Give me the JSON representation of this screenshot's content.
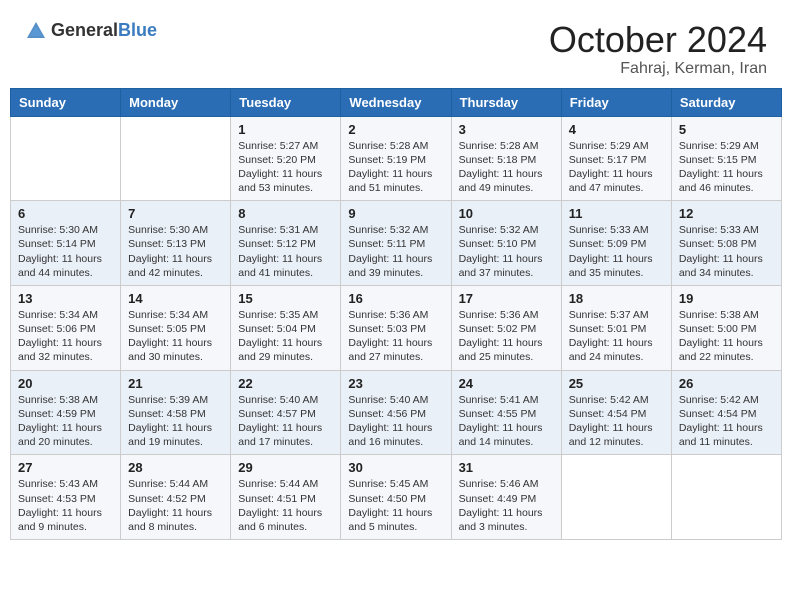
{
  "header": {
    "logo": {
      "general": "General",
      "blue": "Blue"
    },
    "month": "October 2024",
    "location": "Fahraj, Kerman, Iran"
  },
  "weekdays": [
    "Sunday",
    "Monday",
    "Tuesday",
    "Wednesday",
    "Thursday",
    "Friday",
    "Saturday"
  ],
  "weeks": [
    [
      {
        "day": "",
        "content": ""
      },
      {
        "day": "",
        "content": ""
      },
      {
        "day": "1",
        "sunrise": "5:27 AM",
        "sunset": "5:20 PM",
        "daylight": "11 hours and 53 minutes."
      },
      {
        "day": "2",
        "sunrise": "5:28 AM",
        "sunset": "5:19 PM",
        "daylight": "11 hours and 51 minutes."
      },
      {
        "day": "3",
        "sunrise": "5:28 AM",
        "sunset": "5:18 PM",
        "daylight": "11 hours and 49 minutes."
      },
      {
        "day": "4",
        "sunrise": "5:29 AM",
        "sunset": "5:17 PM",
        "daylight": "11 hours and 47 minutes."
      },
      {
        "day": "5",
        "sunrise": "5:29 AM",
        "sunset": "5:15 PM",
        "daylight": "11 hours and 46 minutes."
      }
    ],
    [
      {
        "day": "6",
        "sunrise": "5:30 AM",
        "sunset": "5:14 PM",
        "daylight": "11 hours and 44 minutes."
      },
      {
        "day": "7",
        "sunrise": "5:30 AM",
        "sunset": "5:13 PM",
        "daylight": "11 hours and 42 minutes."
      },
      {
        "day": "8",
        "sunrise": "5:31 AM",
        "sunset": "5:12 PM",
        "daylight": "11 hours and 41 minutes."
      },
      {
        "day": "9",
        "sunrise": "5:32 AM",
        "sunset": "5:11 PM",
        "daylight": "11 hours and 39 minutes."
      },
      {
        "day": "10",
        "sunrise": "5:32 AM",
        "sunset": "5:10 PM",
        "daylight": "11 hours and 37 minutes."
      },
      {
        "day": "11",
        "sunrise": "5:33 AM",
        "sunset": "5:09 PM",
        "daylight": "11 hours and 35 minutes."
      },
      {
        "day": "12",
        "sunrise": "5:33 AM",
        "sunset": "5:08 PM",
        "daylight": "11 hours and 34 minutes."
      }
    ],
    [
      {
        "day": "13",
        "sunrise": "5:34 AM",
        "sunset": "5:06 PM",
        "daylight": "11 hours and 32 minutes."
      },
      {
        "day": "14",
        "sunrise": "5:34 AM",
        "sunset": "5:05 PM",
        "daylight": "11 hours and 30 minutes."
      },
      {
        "day": "15",
        "sunrise": "5:35 AM",
        "sunset": "5:04 PM",
        "daylight": "11 hours and 29 minutes."
      },
      {
        "day": "16",
        "sunrise": "5:36 AM",
        "sunset": "5:03 PM",
        "daylight": "11 hours and 27 minutes."
      },
      {
        "day": "17",
        "sunrise": "5:36 AM",
        "sunset": "5:02 PM",
        "daylight": "11 hours and 25 minutes."
      },
      {
        "day": "18",
        "sunrise": "5:37 AM",
        "sunset": "5:01 PM",
        "daylight": "11 hours and 24 minutes."
      },
      {
        "day": "19",
        "sunrise": "5:38 AM",
        "sunset": "5:00 PM",
        "daylight": "11 hours and 22 minutes."
      }
    ],
    [
      {
        "day": "20",
        "sunrise": "5:38 AM",
        "sunset": "4:59 PM",
        "daylight": "11 hours and 20 minutes."
      },
      {
        "day": "21",
        "sunrise": "5:39 AM",
        "sunset": "4:58 PM",
        "daylight": "11 hours and 19 minutes."
      },
      {
        "day": "22",
        "sunrise": "5:40 AM",
        "sunset": "4:57 PM",
        "daylight": "11 hours and 17 minutes."
      },
      {
        "day": "23",
        "sunrise": "5:40 AM",
        "sunset": "4:56 PM",
        "daylight": "11 hours and 16 minutes."
      },
      {
        "day": "24",
        "sunrise": "5:41 AM",
        "sunset": "4:55 PM",
        "daylight": "11 hours and 14 minutes."
      },
      {
        "day": "25",
        "sunrise": "5:42 AM",
        "sunset": "4:54 PM",
        "daylight": "11 hours and 12 minutes."
      },
      {
        "day": "26",
        "sunrise": "5:42 AM",
        "sunset": "4:54 PM",
        "daylight": "11 hours and 11 minutes."
      }
    ],
    [
      {
        "day": "27",
        "sunrise": "5:43 AM",
        "sunset": "4:53 PM",
        "daylight": "11 hours and 9 minutes."
      },
      {
        "day": "28",
        "sunrise": "5:44 AM",
        "sunset": "4:52 PM",
        "daylight": "11 hours and 8 minutes."
      },
      {
        "day": "29",
        "sunrise": "5:44 AM",
        "sunset": "4:51 PM",
        "daylight": "11 hours and 6 minutes."
      },
      {
        "day": "30",
        "sunrise": "5:45 AM",
        "sunset": "4:50 PM",
        "daylight": "11 hours and 5 minutes."
      },
      {
        "day": "31",
        "sunrise": "5:46 AM",
        "sunset": "4:49 PM",
        "daylight": "11 hours and 3 minutes."
      },
      {
        "day": "",
        "content": ""
      },
      {
        "day": "",
        "content": ""
      }
    ]
  ],
  "labels": {
    "sunrise": "Sunrise:",
    "sunset": "Sunset:",
    "daylight": "Daylight:"
  }
}
